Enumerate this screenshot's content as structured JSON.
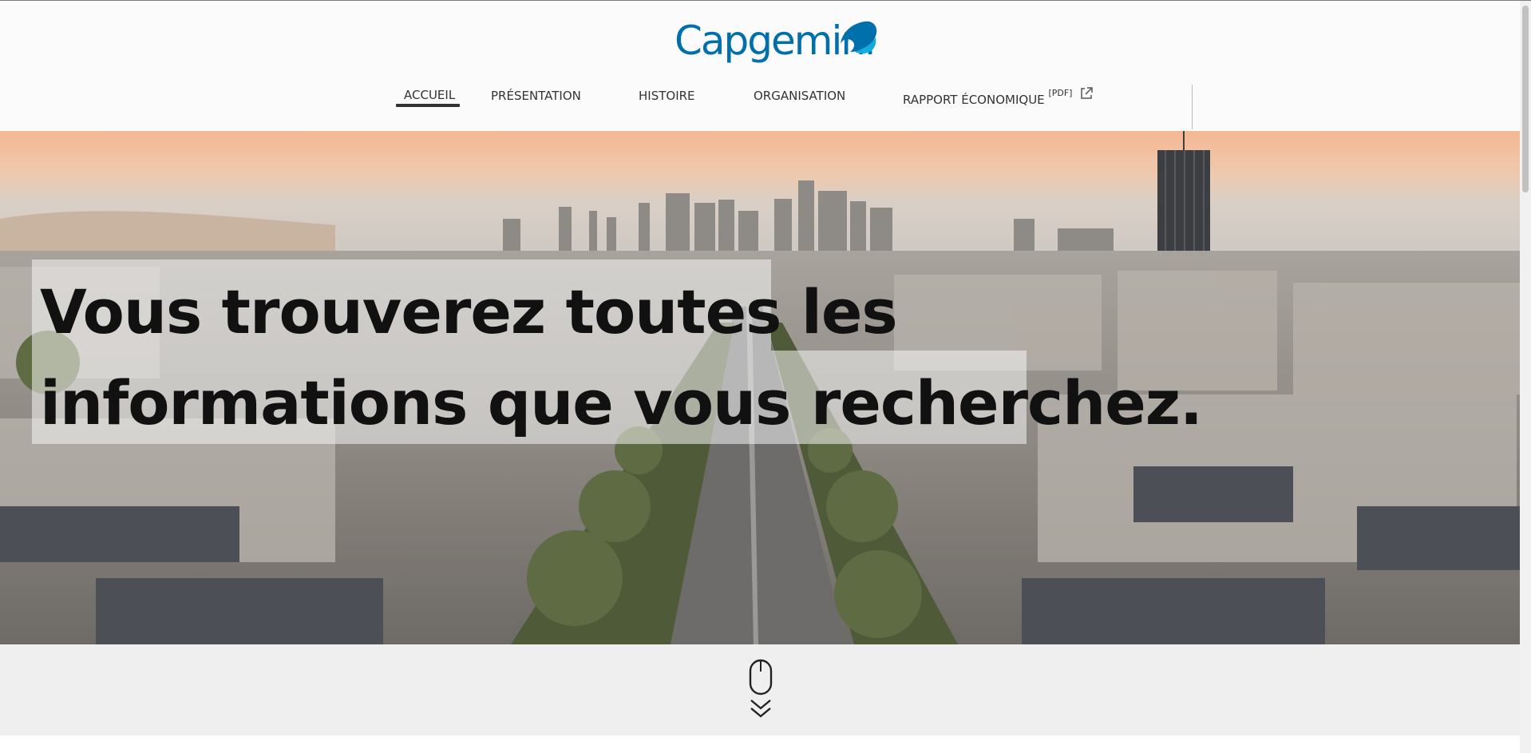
{
  "header": {
    "logo_text": "Capgemini",
    "brand_color": "#0070ad"
  },
  "nav": {
    "items": [
      {
        "label": "ACCUEIL",
        "active": true
      },
      {
        "label": "PRÉSENTATION"
      },
      {
        "label": "HISTOIRE"
      },
      {
        "label": "ORGANISATION"
      },
      {
        "label": "RAPPORT ÉCONOMIQUE",
        "suffix": "[PDF]",
        "icon": "external-link-icon"
      }
    ]
  },
  "hero": {
    "headline_line1": "Vous trouverez toutes les",
    "headline_line2": "informations que vous recherchez.",
    "image": "paris-skyline-la-defense-photo"
  },
  "scroll": {
    "icon": "mouse-scroll-down-icon"
  }
}
